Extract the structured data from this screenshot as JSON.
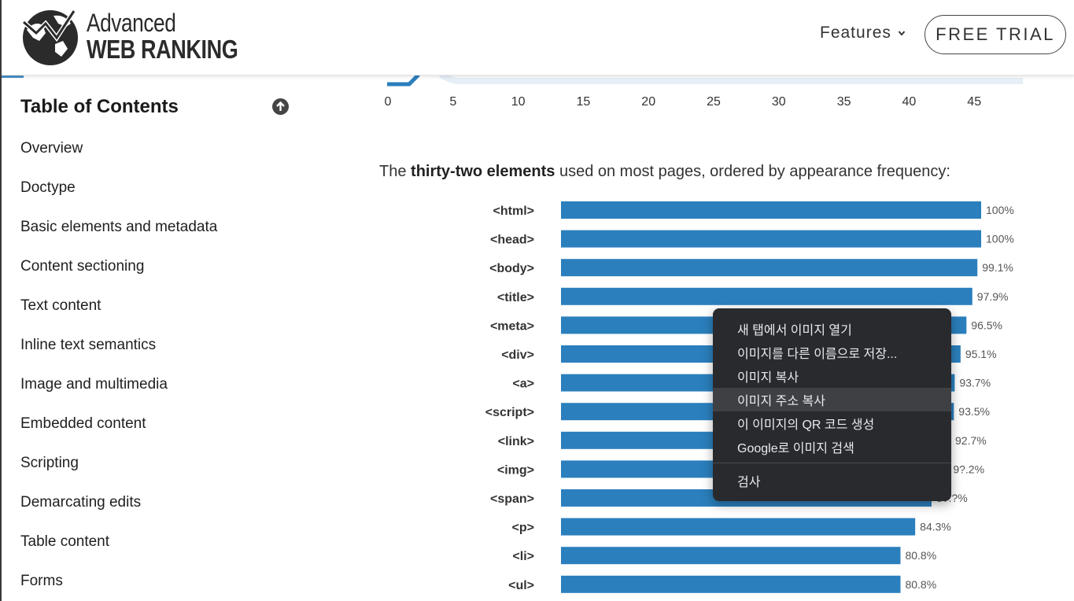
{
  "header": {
    "logo_line1": "Advanced",
    "logo_line2": "WEB RANKING",
    "nav_features": "Features",
    "free_trial": "FREE TRIAL"
  },
  "sidebar": {
    "title": "Table of Contents",
    "items": [
      "Overview",
      "Doctype",
      "Basic elements and metadata",
      "Content sectioning",
      "Text content",
      "Inline text semantics",
      "Image and multimedia",
      "Embedded content",
      "Scripting",
      "Demarcating edits",
      "Table content",
      "Forms"
    ]
  },
  "top_axis_ticks": [
    "0",
    "5",
    "10",
    "15",
    "20",
    "25",
    "30",
    "35",
    "40",
    "45"
  ],
  "intro": {
    "prefix": "The ",
    "bold": "thirty-two elements",
    "suffix": " used on most pages, ordered by appearance frequency:"
  },
  "chart_data": {
    "type": "bar",
    "orientation": "horizontal",
    "categories": [
      "<html>",
      "<head>",
      "<body>",
      "<title>",
      "<meta>",
      "<div>",
      "<a>",
      "<script>",
      "<link>",
      "<img>",
      "<span>",
      "<p>",
      "<li>",
      "<ul>"
    ],
    "values": [
      100,
      100,
      99.1,
      97.9,
      96.5,
      95.1,
      93.7,
      93.5,
      92.7,
      92.2,
      88.2,
      84.3,
      80.8,
      80.8
    ],
    "value_labels": [
      "100%",
      "100%",
      "99.1%",
      "97.9%",
      "96.5%",
      "95.1%",
      "93.7%",
      "93.5%",
      "92.7%",
      "9?.2%",
      "8?.?%",
      "84.3%",
      "80.8%",
      "80.8%"
    ],
    "bar_color": "#2b7fbd",
    "xlim": [
      0,
      100
    ]
  },
  "context_menu": {
    "items": [
      "새 탭에서 이미지 열기",
      "이미지를 다른 이름으로 저장...",
      "이미지 복사",
      "이미지 주소 복사",
      "이 이미지의 QR 코드 생성",
      "Google로 이미지 검색",
      "검사"
    ],
    "hovered_index": 3
  },
  "colors": {
    "accent": "#2b7fbd",
    "menu_bg": "#292a2d",
    "menu_hover": "#3f4044"
  }
}
